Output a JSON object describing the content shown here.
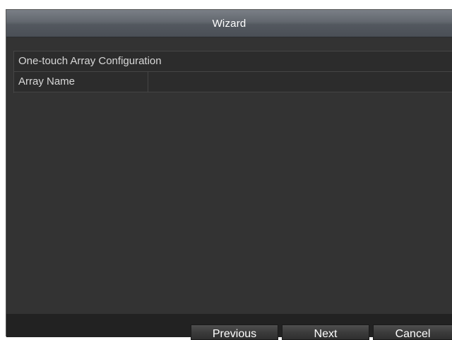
{
  "window": {
    "title": "Wizard"
  },
  "config": {
    "section_label": "One-touch Array Configuration",
    "array_name_label": "Array Name",
    "array_name_value": ""
  },
  "buttons": {
    "previous": "Previous",
    "next": "Next",
    "cancel": "Cancel"
  }
}
